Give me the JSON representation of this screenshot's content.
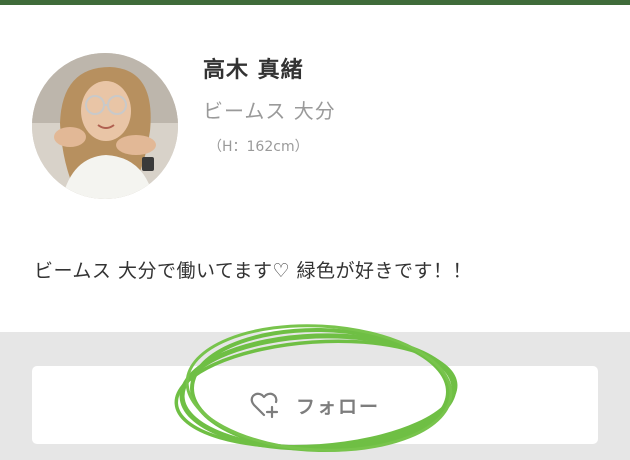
{
  "profile": {
    "name": "高木 真緒",
    "shop": "ビームス 大分",
    "height": "（H：162cm）",
    "bio": "ビームス 大分で働いてます♡ 緑色が好きです！！"
  },
  "follow": {
    "label": "フォロー",
    "icon": "heart-plus-icon"
  },
  "colors": {
    "top_bar": "#3f6b3a",
    "annotation": "#6fbf44",
    "footer_bg": "#e6e6e6"
  }
}
